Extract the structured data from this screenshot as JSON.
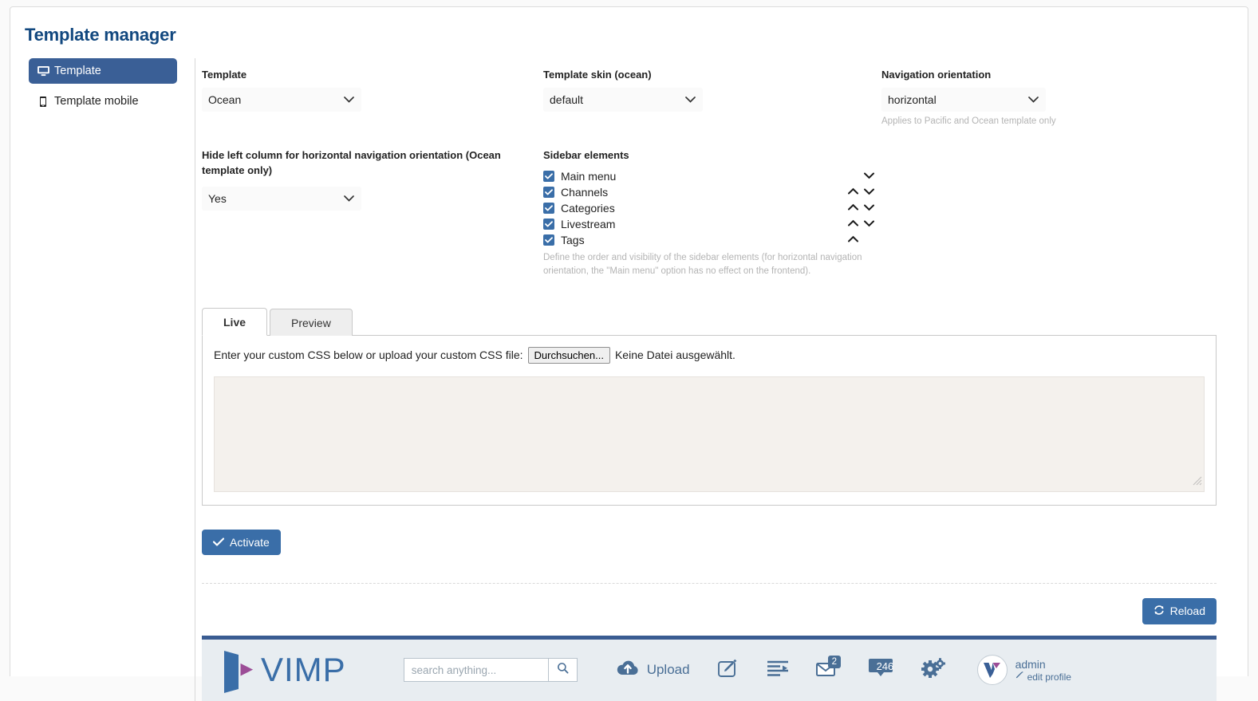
{
  "page": {
    "title": "Template manager"
  },
  "sidebar": {
    "items": [
      {
        "label": "Template",
        "icon": "desktop-icon",
        "active": true
      },
      {
        "label": "Template mobile",
        "icon": "mobile-icon",
        "active": false
      }
    ]
  },
  "form": {
    "template": {
      "label": "Template",
      "value": "Ocean"
    },
    "skin": {
      "label": "Template skin (ocean)",
      "value": "default"
    },
    "navigation": {
      "label": "Navigation orientation",
      "value": "horizontal",
      "hint": "Applies to Pacific and Ocean template only"
    },
    "hide_left_column": {
      "label": "Hide left column for horizontal navigation orientation (Ocean template only)",
      "value": "Yes"
    },
    "sidebar_elements": {
      "label": "Sidebar elements",
      "hint": "Define the order and visibility of the sidebar elements (for horizontal navigation orientation, the \"Main menu\" option has no effect on the frontend).",
      "items": [
        {
          "label": "Main menu",
          "checked": true,
          "up": false,
          "down": true
        },
        {
          "label": "Channels",
          "checked": true,
          "up": true,
          "down": true
        },
        {
          "label": "Categories",
          "checked": true,
          "up": true,
          "down": true
        },
        {
          "label": "Livestream",
          "checked": true,
          "up": true,
          "down": true
        },
        {
          "label": "Tags",
          "checked": true,
          "up": true,
          "down": false
        }
      ]
    }
  },
  "tabs": [
    {
      "label": "Live",
      "active": true
    },
    {
      "label": "Preview",
      "active": false
    }
  ],
  "css_panel": {
    "instruction": "Enter your custom CSS below or upload your custom CSS file:",
    "file_button": "Durchsuchen...",
    "file_status": "Keine Datei ausgewählt.",
    "textarea_value": ""
  },
  "actions": {
    "activate": "Activate",
    "reload": "Reload"
  },
  "footer": {
    "logo_text": "VIMP",
    "search": {
      "placeholder": "search anything...",
      "value": ""
    },
    "nav": [
      {
        "label": "Upload",
        "icon": "cloud-upload-icon",
        "badge": ""
      },
      {
        "label": "",
        "icon": "edit-square-icon",
        "badge": ""
      },
      {
        "label": "",
        "icon": "list-indent-icon",
        "badge": ""
      },
      {
        "label": "",
        "icon": "envelope-icon",
        "badge": "2"
      },
      {
        "label": "",
        "icon": "media-screen-icon",
        "badge": "246"
      },
      {
        "label": "",
        "icon": "gears-icon",
        "badge": ""
      }
    ],
    "user": {
      "name": "admin",
      "edit_label": "edit profile"
    }
  },
  "colors": {
    "accent": "#3a6ea8",
    "title": "#12487f",
    "footer_bar": "#e8edf1",
    "footer_rule": "#3a5c92",
    "logo_purple": "#9c4d97"
  }
}
